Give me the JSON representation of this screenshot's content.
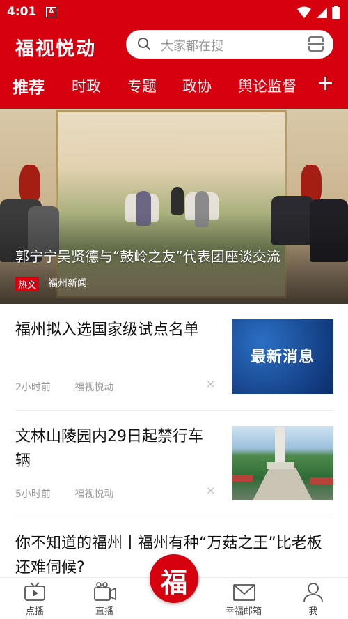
{
  "status_bar": {
    "time": "4:01",
    "notification_glyph": "A",
    "icons": [
      "wifi-icon",
      "signal-icon",
      "battery-icon"
    ]
  },
  "header": {
    "app_title": "福视悦动",
    "search_placeholder": "大家都在搜",
    "search_icon": "search-icon",
    "scan_icon": "scan-icon"
  },
  "tabs": {
    "items": [
      {
        "label": "推荐",
        "active": true
      },
      {
        "label": "时政",
        "active": false
      },
      {
        "label": "专题",
        "active": false
      },
      {
        "label": "政协",
        "active": false
      },
      {
        "label": "舆论监督",
        "active": false
      }
    ],
    "add_label": "+"
  },
  "hero": {
    "title": "郭宁宁吴贤德与“鼓岭之友”代表团座谈交流",
    "badge": "热文",
    "source": "福州新闻"
  },
  "news": [
    {
      "title": "福州拟入选国家级试点名单",
      "time": "2小时前",
      "source": "福视悦动",
      "thumb_text": "最新消息"
    },
    {
      "title": "文林山陵园内29日起禁行车辆",
      "time": "5小时前",
      "source": "福视悦动",
      "thumb_text": ""
    },
    {
      "title": "你不知道的福州丨福州有种“万菇之王”比老板还难伺候?",
      "time": "",
      "source": "",
      "thumb_text": ""
    }
  ],
  "close_glyph": "×",
  "bottom_nav": {
    "items": [
      {
        "label": "点播",
        "icon": "tv-icon"
      },
      {
        "label": "直播",
        "icon": "video-camera-icon"
      },
      {
        "label": "",
        "icon": "fu-logo-icon"
      },
      {
        "label": "幸福邮箱",
        "icon": "mail-icon"
      },
      {
        "label": "我",
        "icon": "profile-icon"
      }
    ],
    "center_glyph": "福"
  },
  "colors": {
    "brand_red": "#d7000f",
    "text_primary": "#111111",
    "text_meta": "#999999"
  }
}
